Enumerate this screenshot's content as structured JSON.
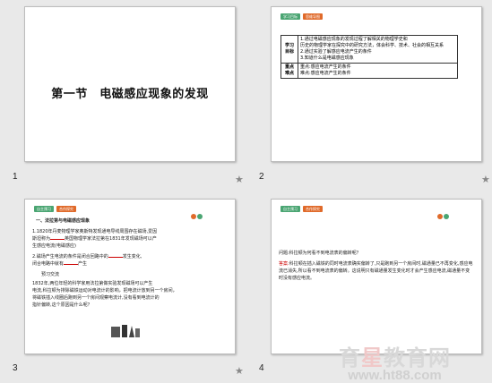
{
  "slides": [
    {
      "number": "1",
      "title": "第一节　电磁感应现象的发现"
    },
    {
      "number": "2",
      "tags": [
        "学习目标",
        "思维导图"
      ],
      "table": [
        {
          "label": "学习目标",
          "lines": [
            "1.通过电磁感应现象的发现过程了解相关的物理学史和",
            "历史的物理学家在探究中的研究方法，体会科学、技术、社会的相互关系",
            "2.通过实验了解感应电流产生的条件",
            "3.知道什么是电磁感应现象"
          ]
        },
        {
          "label": "重点难点",
          "lines": [
            "重点:感应电流产生的条件",
            "难点:感应电流产生的条件"
          ]
        }
      ]
    },
    {
      "number": "3",
      "tags": [
        "自主预习",
        "合作探究"
      ],
      "heading": "一、法拉第与电磁感应现象",
      "p1a": "1.1820年丹麦物理学家奥斯特发现通电导线周围存在磁场,爱因",
      "p1b": "斯坦称为",
      "p1c": "英国物理学家法拉第在1831年发现磁场可以产",
      "p1d": "生感应电流(电磁感应)",
      "p2a": "2.磁场产生电流的条件是闭合回路中的",
      "p2b": "发生变化,",
      "p2c": "闭合电路中就有",
      "p2d": "产生",
      "sub": "预习交流",
      "p3a": "1832年,两位年轻的科学家用法拉第做实验发现磁场可以产生",
      "p3b": "电流,科拉顿为排除磁铁运动对电流计的影响，把电流计放到另一个房间，",
      "p3c": "将磁铁插入线圈后跑到另一个房间观察电流计,没有看到电流计的",
      "p3d": "指针偏转,这个原因是什么呢？"
    },
    {
      "number": "4",
      "tags": [
        "自主预习",
        "合作探究"
      ],
      "q": "问题:科拉顿为何看不到电流表的偏转呢？",
      "answer_label": "答案:",
      "answer": "科拉顿在插入磁铁的同时电流表确实偏转了,只是跑到另一个房间时,磁通量已不再变化,感应电流已消失,所以看不到电流表的偏转。这说明只有磁通量发生变化时才会产生感应电流,磁通量不变时没有感应电流。"
    }
  ],
  "watermark": {
    "name_a": "育",
    "name_red": "星",
    "name_b": "教育网",
    "url": "www.ht88.com"
  },
  "colors": {
    "green": "#4aa572",
    "orange": "#e06a2a"
  }
}
